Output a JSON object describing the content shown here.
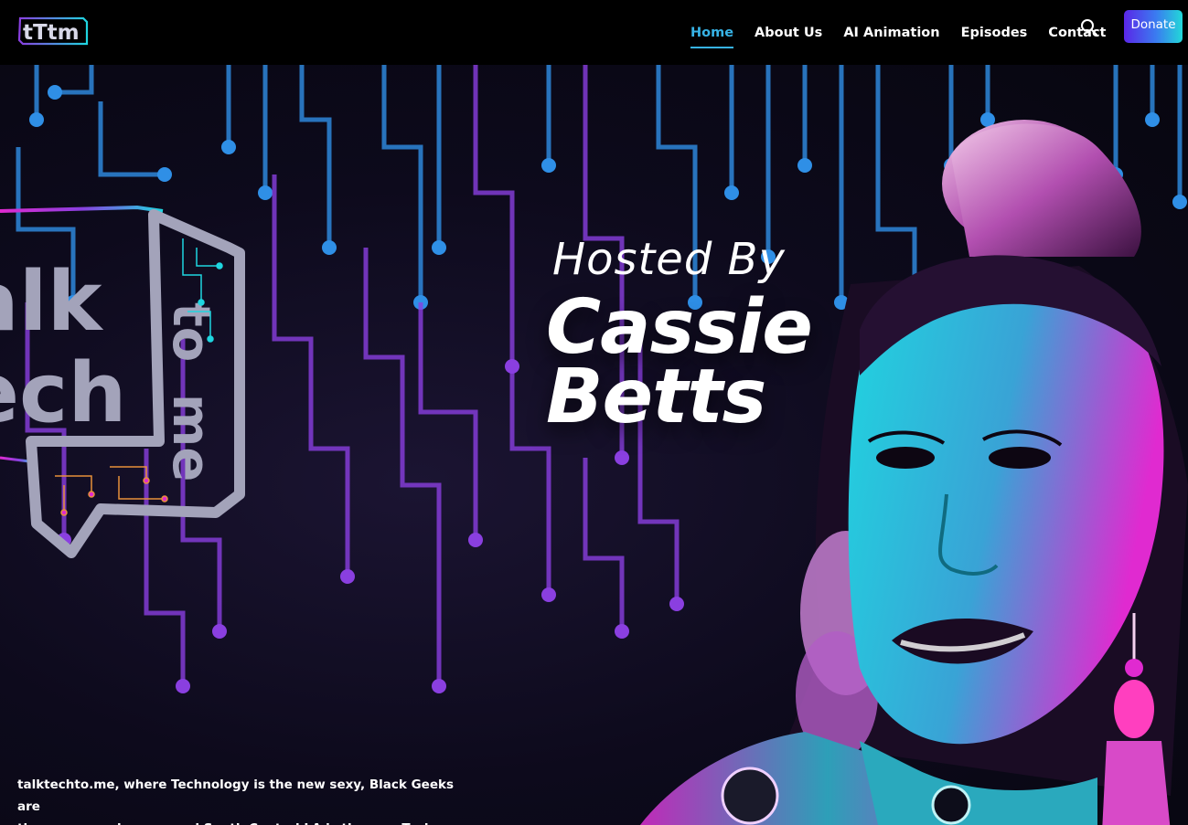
{
  "brand": {
    "logo_text": "tTtm"
  },
  "nav": {
    "items": [
      {
        "label": "Home",
        "active": true
      },
      {
        "label": "About Us",
        "active": false
      },
      {
        "label": "AI Animation",
        "active": false
      },
      {
        "label": "Episodes",
        "active": false
      },
      {
        "label": "Contact",
        "active": false
      }
    ],
    "search_icon": "search-icon",
    "donate_label": "Donate"
  },
  "hero": {
    "logo_words": [
      "alk",
      "ech",
      "to",
      "me"
    ],
    "hosted_by": "Hosted By",
    "host_first": "Cassie",
    "host_last": "Betts",
    "tagline_line1": "talktechto.me, where Technology is the new sexy, Black Geeks are",
    "tagline_line2": "the new superheroes, and South Central LA is the new Tech Mecca."
  },
  "colors": {
    "accent": "#37b3e6",
    "circuit_blue": "#2f8fe6",
    "circuit_purple": "#8a3fe0",
    "donate_start": "#5a27e8",
    "donate_end": "#22d8d8",
    "portrait_cyan": "#1fd6e0",
    "portrait_magenta": "#e02ad0"
  }
}
